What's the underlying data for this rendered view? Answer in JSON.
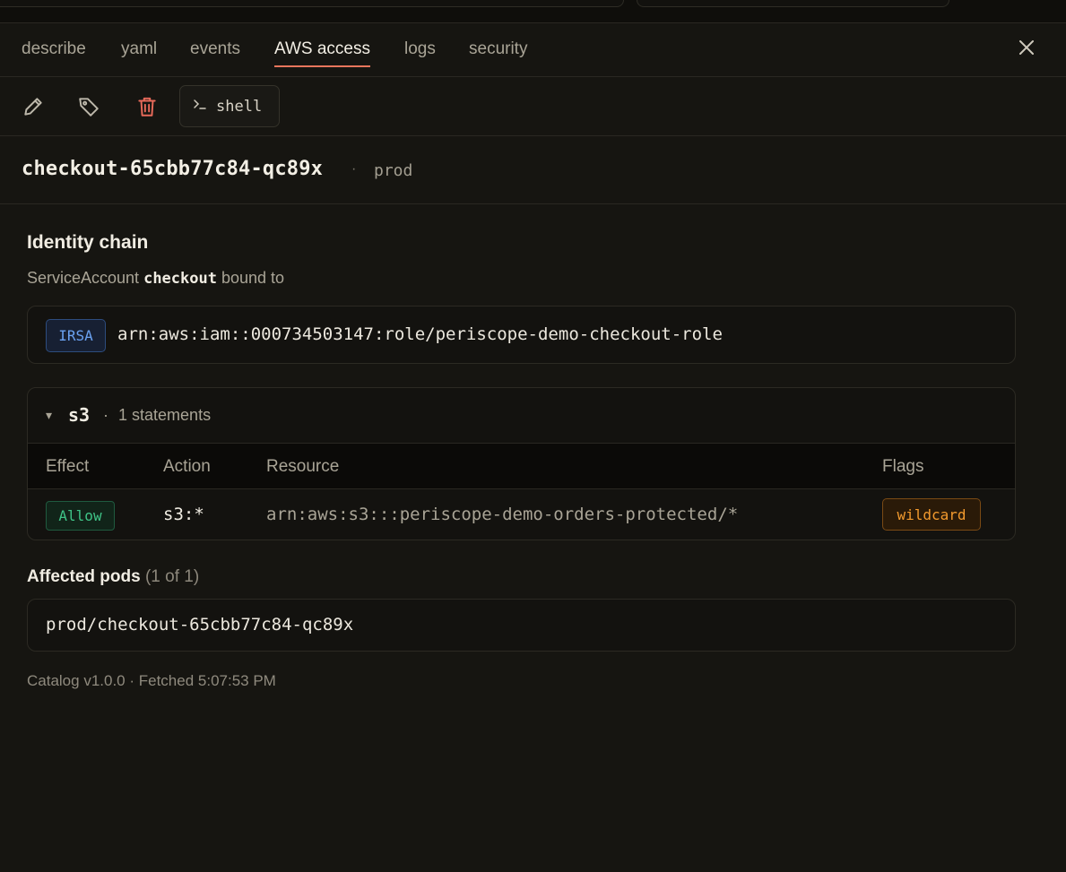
{
  "tabs": [
    {
      "label": "describe"
    },
    {
      "label": "yaml"
    },
    {
      "label": "events"
    },
    {
      "label": "AWS access",
      "active": true
    },
    {
      "label": "logs"
    },
    {
      "label": "security"
    }
  ],
  "toolbar": {
    "edit_icon": "pencil-icon",
    "label_icon": "tag-icon",
    "delete_icon": "trash-icon",
    "shell_label": "shell"
  },
  "header": {
    "pod_name": "checkout-65cbb77c84-qc89x",
    "separator": "·",
    "namespace": "prod"
  },
  "identity": {
    "title": "Identity chain",
    "prefix": "ServiceAccount",
    "service_account": "checkout",
    "suffix": "bound to",
    "badge": "IRSA",
    "role_arn": "arn:aws:iam::000734503147:role/periscope-demo-checkout-role"
  },
  "policy": {
    "caret": "▾",
    "service": "s3",
    "separator": "·",
    "statements": "1 statements",
    "columns": [
      "Effect",
      "Action",
      "Resource",
      "Flags"
    ],
    "rows": [
      {
        "effect": "Allow",
        "action": "s3:*",
        "resource": "arn:aws:s3:::periscope-demo-orders-protected/*",
        "flag": "wildcard"
      }
    ]
  },
  "affected": {
    "title": "Affected pods",
    "count": "(1 of 1)",
    "pods": [
      "prod/checkout-65cbb77c84-qc89x"
    ]
  },
  "footer": "Catalog v1.0.0 · Fetched 5:07:53 PM",
  "colors": {
    "accent": "#e8765c",
    "allow": "#3fc487",
    "irsa": "#6aa1f0",
    "wildcard": "#f29a2e",
    "delete": "#e86a5a"
  }
}
